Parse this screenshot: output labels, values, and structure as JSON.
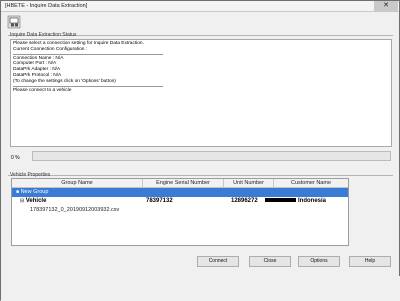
{
  "window": {
    "title": "[HBETE - Inquire Data Extraction]",
    "close_glyph": "✕"
  },
  "toolbar": {
    "icon": "tool-icon"
  },
  "status_panel": {
    "label": "Inquire Data Extraction Status",
    "lines": [
      "Please select a connection setting for Inquire Data Extraction.",
      "Current Connection Configuration :",
      "Connection Name     : N/A",
      "Computer Port        : N/A",
      "DataPrk Adapter     : N/A",
      "DataPrk Protocol    : N/A",
      "(To change the settings click on 'Options' button)",
      "Please connect to a vehicle"
    ],
    "progress_label": "0 %",
    "progress_value": 0
  },
  "vehicle_panel": {
    "label": "Vehicle Properties",
    "columns": [
      "Group Name",
      "Engine Serial Number",
      "Unit Number",
      "Customer Name"
    ],
    "group_row": {
      "glyph": "■",
      "name": "New Group"
    },
    "vehicle_row": {
      "glyph": "⊟",
      "name": "Vehicle",
      "engine_serial": "78397132",
      "unit_number": "12896272",
      "customer_name": "Indonesia"
    },
    "file_row": {
      "name": "178397132_0_20190912003932.csv"
    }
  },
  "buttons": {
    "connect": "Connect",
    "close": "Close",
    "options": "Options",
    "help": "Help"
  },
  "colors": {
    "selection": "#3a7bd5",
    "progress": "#06b025"
  }
}
